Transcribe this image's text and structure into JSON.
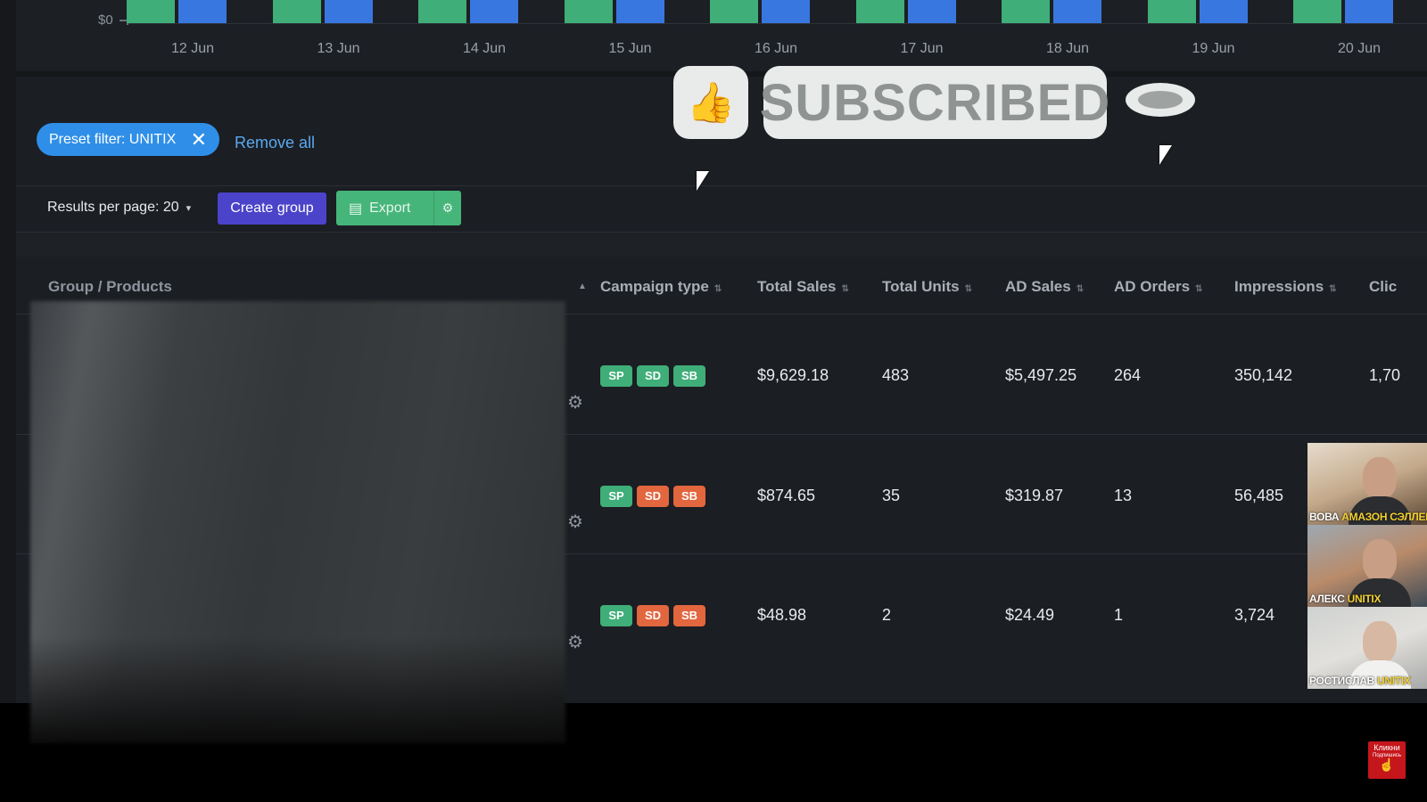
{
  "chart": {
    "y_tick": "$0",
    "x_ticks": [
      "12 Jun",
      "13 Jun",
      "14 Jun",
      "15 Jun",
      "16 Jun",
      "17 Jun",
      "18 Jun",
      "19 Jun",
      "20 Jun"
    ],
    "colors": {
      "series_a": "#3fae78",
      "series_b": "#3877e0"
    }
  },
  "filters": {
    "chip_label": "Preset filter: UNITIX",
    "close_glyph": "✕",
    "remove_all": "Remove all"
  },
  "toolbar": {
    "results_per_page": "Results per page: 20",
    "create_group": "Create group",
    "export": "Export"
  },
  "table": {
    "columns": [
      "Group / Products",
      "Campaign type",
      "Total Sales",
      "Total Units",
      "AD Sales",
      "AD Orders",
      "Impressions",
      "Clic"
    ],
    "rows": [
      {
        "badges": [
          "SP",
          "SD",
          "SB"
        ],
        "badge_colors": [
          "green",
          "green",
          "green"
        ],
        "total_sales": "$9,629.18",
        "total_units": "483",
        "ad_sales": "$5,497.25",
        "ad_orders": "264",
        "impressions": "350,142",
        "clicks": "1,70"
      },
      {
        "badges": [
          "SP",
          "SD",
          "SB"
        ],
        "badge_colors": [
          "green",
          "orange",
          "orange"
        ],
        "total_sales": "$874.65",
        "total_units": "35",
        "ad_sales": "$319.87",
        "ad_orders": "13",
        "impressions": "56,485",
        "clicks": ""
      },
      {
        "badges": [
          "SP",
          "SD",
          "SB"
        ],
        "badge_colors": [
          "green",
          "orange",
          "orange"
        ],
        "total_sales": "$48.98",
        "total_units": "2",
        "ad_sales": "$24.49",
        "ad_orders": "1",
        "impressions": "3,724",
        "clicks": ""
      }
    ]
  },
  "overlay": {
    "subscribe_label": "SUBSCRIBED"
  },
  "webcams": [
    {
      "name": "ВОВА",
      "role": "АМАЗОН СЭЛЛЕР"
    },
    {
      "name": "АЛЕКС",
      "role": "UNITIX"
    },
    {
      "name": "РОСТИСЛАВ",
      "role": "UNITIX"
    }
  ],
  "click_badge": {
    "line1": "Кликни",
    "line2": "Подпишись"
  }
}
